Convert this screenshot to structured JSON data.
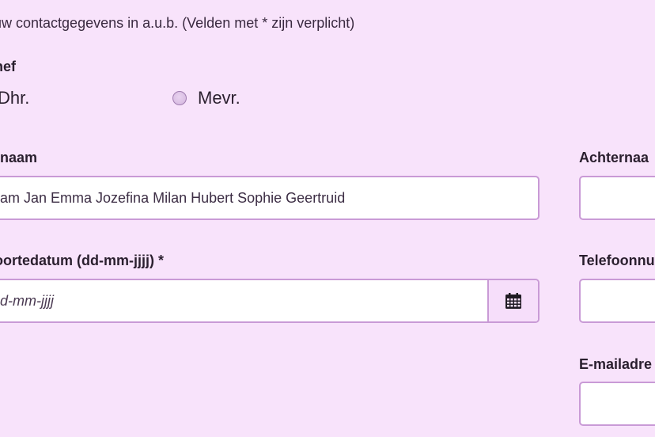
{
  "intro": "uw contactgegevens in a.u.b. (Velden met * zijn verplicht)",
  "title_section": {
    "label": "hef",
    "options": [
      {
        "label": "Dhr."
      },
      {
        "label": "Mevr."
      }
    ]
  },
  "first_names": {
    "label": "rnaam",
    "value": "am  Jan  Emma  Jozefina  Milan  Hubert  Sophie  Geertruid"
  },
  "last_name": {
    "label": "Achternaa",
    "value": ""
  },
  "birth_date": {
    "label": "oortedatum (dd-mm-jjjj) *",
    "placeholder": "d-mm-jjjj",
    "button_icon": "calendar-icon"
  },
  "phone": {
    "label": "Telefoonnu",
    "value": ""
  },
  "email": {
    "label": "E-mailadre",
    "value": ""
  },
  "colors": {
    "background": "#f8e3fb",
    "field_border": "#c99ad6",
    "calendar_button": "#f6defa"
  }
}
